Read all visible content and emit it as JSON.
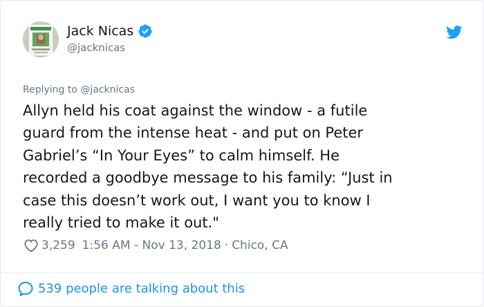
{
  "author": {
    "name": "Jack Nicas",
    "handle": "@jacknicas"
  },
  "reply_to": "Replying to @jacknicas",
  "tweet_text": "Allyn held his coat against the window - a futile\nguard from the intense heat - and put on Peter\nGabriel’s “In Your Eyes” to calm himself. He\nrecorded a goodbye message to his family: “Just in\ncase this doesn’t work out, I want you to know I\nreally tried to make it out.\"",
  "meta": {
    "likes": "3,259",
    "timestamp": "1:56 AM - Nov 13, 2018",
    "separator": "·",
    "location": "Chico, CA"
  },
  "conversation": "539 people are talking about this",
  "icons": {
    "verified": "verified-badge-icon",
    "twitter": "twitter-bird-icon",
    "like": "heart-icon",
    "conversation": "speech-bubble-icon"
  },
  "colors": {
    "accent": "#1b95e0",
    "verified": "#1da1f2",
    "text": "#14171a",
    "muted": "#657786"
  }
}
